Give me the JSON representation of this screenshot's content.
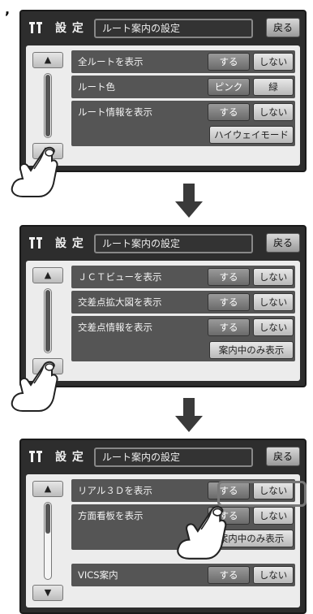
{
  "corner_mark": ",",
  "screens": [
    {
      "icon": "tool-icon",
      "settings_label": "設 定",
      "breadcrumb": "ルート案内の設定",
      "back": "戻る",
      "rows": [
        {
          "label": "全ルートを表示",
          "options": [
            "する",
            "しない"
          ]
        },
        {
          "label": "ルート色",
          "options": [
            "ピンク",
            "緑"
          ]
        },
        {
          "label": "ルート情報を表示",
          "options": [
            "する",
            "しない"
          ]
        },
        {
          "label": "",
          "options": [
            "ハイウェイモード"
          ]
        }
      ]
    },
    {
      "icon": "tool-icon",
      "settings_label": "設 定",
      "breadcrumb": "ルート案内の設定",
      "back": "戻る",
      "rows": [
        {
          "label": "ＪＣＴビューを表示",
          "options": [
            "する",
            "しない"
          ]
        },
        {
          "label": "交差点拡大図を表示",
          "options": [
            "する",
            "しない"
          ]
        },
        {
          "label": "交差点情報を表示",
          "options": [
            "する",
            "しない"
          ]
        },
        {
          "label": "",
          "options": [
            "案内中のみ表示"
          ]
        }
      ]
    },
    {
      "icon": "tool-icon",
      "settings_label": "設 定",
      "breadcrumb": "ルート案内の設定",
      "back": "戻る",
      "rows": [
        {
          "label": "リアル３Ｄを表示",
          "options": [
            "する",
            "しない"
          ]
        },
        {
          "label": "方面看板を表示",
          "options": [
            "する",
            "しない"
          ]
        },
        {
          "label": "",
          "options": [
            "案内中のみ表示"
          ]
        },
        {
          "label": "VICS案内",
          "options": [
            "する",
            "しない"
          ]
        }
      ]
    }
  ],
  "icons": {
    "scroll_up": "▲",
    "scroll_down": "▼",
    "arrow": "down-arrow-icon",
    "hand": "pointing-hand-icon"
  }
}
